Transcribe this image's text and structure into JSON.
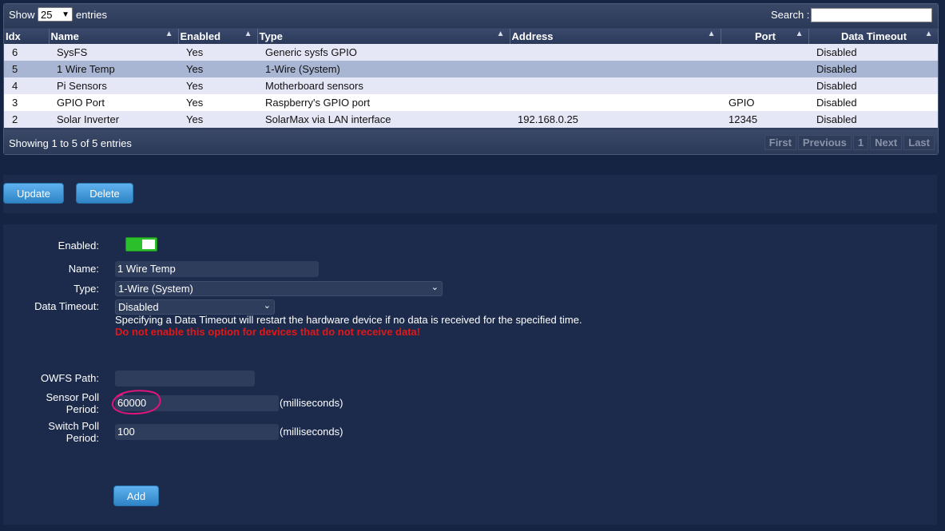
{
  "table": {
    "show_label": "Show",
    "page_size": "25",
    "entries_label": "entries",
    "search_label": "Search :",
    "search_value": "",
    "columns": [
      "Idx",
      "Name",
      "Enabled",
      "Type",
      "Address",
      "Port",
      "Data Timeout"
    ],
    "rows": [
      {
        "idx": "6",
        "name": "SysFS",
        "enabled": "Yes",
        "type": "Generic sysfs GPIO",
        "address": "",
        "port": "",
        "timeout": "Disabled"
      },
      {
        "idx": "5",
        "name": "1 Wire Temp",
        "enabled": "Yes",
        "type": "1-Wire (System)",
        "address": "",
        "port": "",
        "timeout": "Disabled"
      },
      {
        "idx": "4",
        "name": "Pi Sensors",
        "enabled": "Yes",
        "type": "Motherboard sensors",
        "address": "",
        "port": "",
        "timeout": "Disabled"
      },
      {
        "idx": "3",
        "name": "GPIO Port",
        "enabled": "Yes",
        "type": "Raspberry's GPIO port",
        "address": "",
        "port": "GPIO",
        "timeout": "Disabled"
      },
      {
        "idx": "2",
        "name": "Solar Inverter",
        "enabled": "Yes",
        "type": "SolarMax via LAN interface",
        "address": "192.168.0.25",
        "port": "12345",
        "timeout": "Disabled"
      }
    ],
    "showing_text": "Showing 1 to 5 of 5 entries",
    "pager": {
      "first": "First",
      "previous": "Previous",
      "page": "1",
      "next": "Next",
      "last": "Last"
    }
  },
  "actions": {
    "update": "Update",
    "delete": "Delete"
  },
  "form": {
    "enabled_label": "Enabled:",
    "enabled_value": true,
    "name_label": "Name:",
    "name_value": "1 Wire Temp",
    "type_label": "Type:",
    "type_value": "1-Wire (System)",
    "timeout_label": "Data Timeout:",
    "timeout_value": "Disabled",
    "timeout_note": "Specifying a Data Timeout will restart the hardware device if no data is received for the specified time.",
    "timeout_warning": "Do not enable this option for devices that do not receive data!",
    "owfs_label": "OWFS Path:",
    "owfs_value": "",
    "sensor_poll_label_1": "Sensor Poll",
    "sensor_poll_label_2": "Period:",
    "sensor_poll_value": "60000",
    "switch_poll_label_1": "Switch Poll",
    "switch_poll_label_2": "Period:",
    "switch_poll_value": "100",
    "unit": "(milliseconds)",
    "add_label": "Add"
  },
  "colors": {
    "background": "#162443",
    "panel": "#1c2b4c",
    "row_selected": "#a9b6d3",
    "toggle_on": "#2bbf2b",
    "button": "#3a95d8",
    "warning": "#e01818",
    "annotation": "#e0157a"
  }
}
